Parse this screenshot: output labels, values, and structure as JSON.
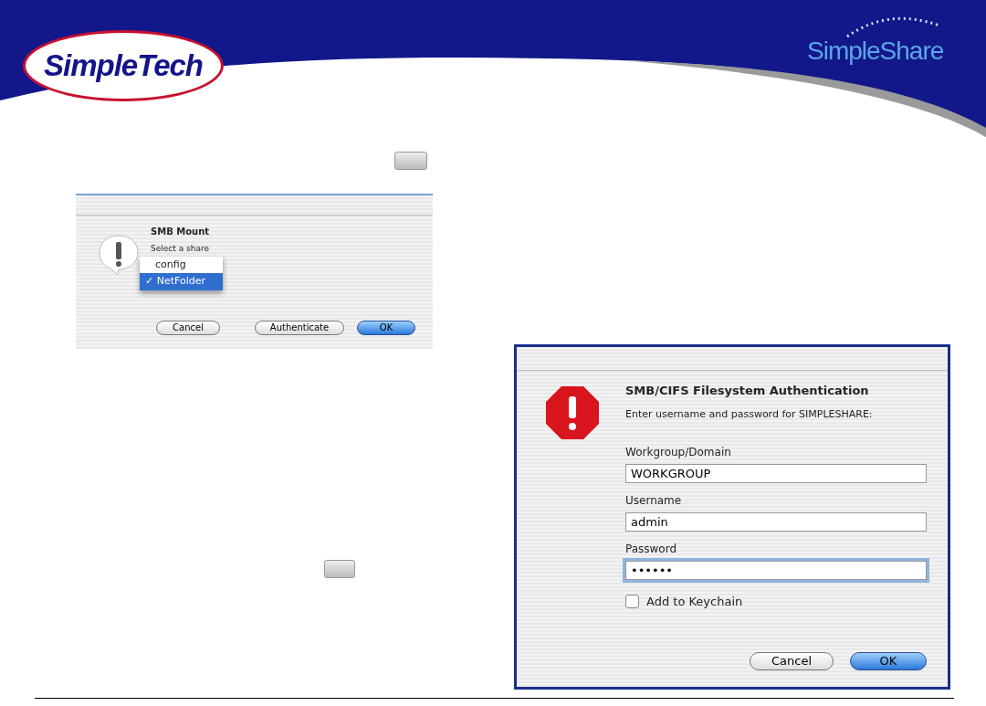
{
  "header": {
    "logo_left": "SimpleTech",
    "logo_right": "SimpleShare"
  },
  "mount_dialog": {
    "title": "SMB Mount",
    "prompt": "Select a share",
    "check": "✓",
    "shares": [
      {
        "label": "config",
        "selected": false
      },
      {
        "label": "NetFolder",
        "selected": true
      }
    ],
    "buttons": [
      {
        "label": "Cancel",
        "default": false
      },
      {
        "label": "Authenticate",
        "default": false
      },
      {
        "label": "OK",
        "default": true
      }
    ]
  },
  "auth_dialog": {
    "title": "SMB/CIFS Filesystem Authentication",
    "prompt": "Enter username and password for SIMPLESHARE:",
    "fields": [
      {
        "label": "Workgroup/Domain",
        "value": "WORKGROUP",
        "focused": false
      },
      {
        "label": "Username",
        "value": "admin",
        "focused": false
      },
      {
        "label": "Password",
        "value": "••••••",
        "focused": true
      }
    ],
    "keychain": {
      "label": "Add to Keychain",
      "checked": false
    },
    "buttons": [
      {
        "label": "Cancel",
        "default": false
      },
      {
        "label": "OK",
        "default": true
      }
    ]
  }
}
